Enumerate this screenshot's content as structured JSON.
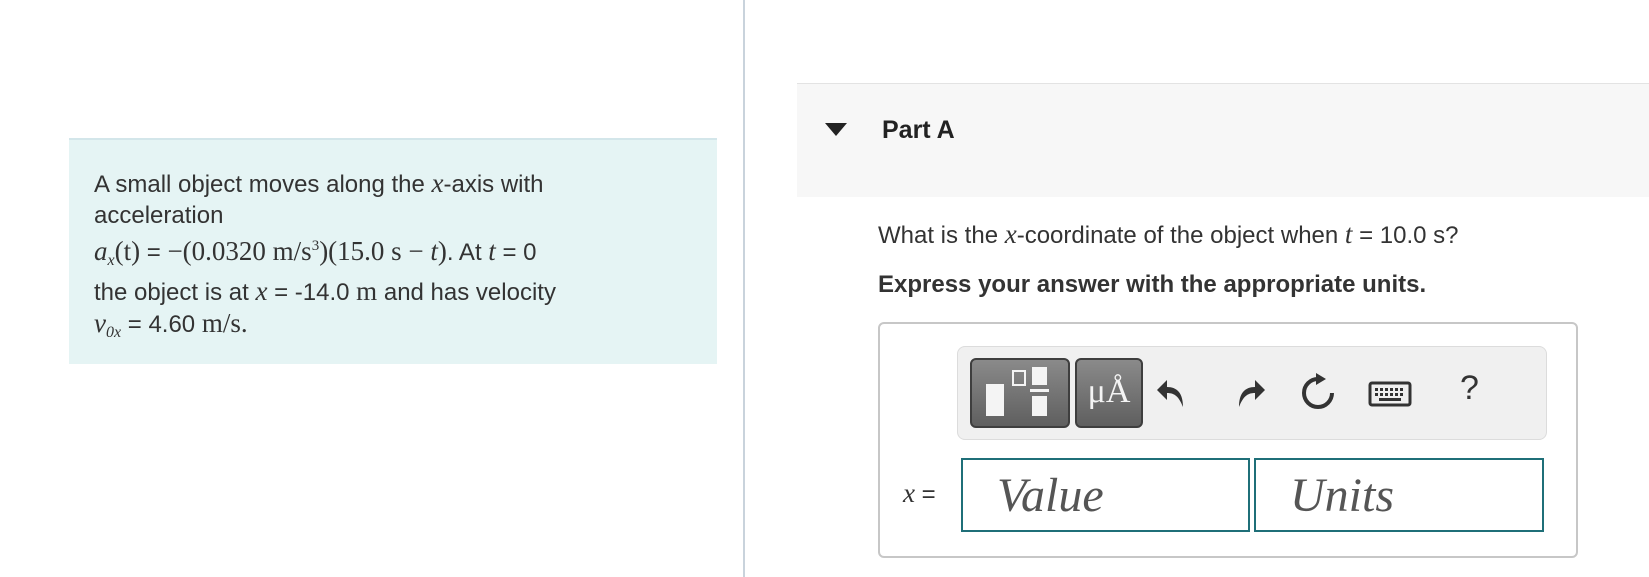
{
  "problem": {
    "line1_text": "A small object moves along the ",
    "line1_var": "x",
    "line1_after": "-axis with",
    "line2": "acceleration",
    "accel_symbol": "a",
    "accel_sub": "x",
    "accel_arg": "(t)",
    "accel_eq": " = ",
    "accel_expr_a": "−(0.0320 m/s",
    "accel_expr_exp": "3",
    "accel_expr_b": ")(15.0 s − ",
    "accel_expr_t": "t",
    "accel_expr_c": ")",
    "at_text": ". At ",
    "at_var": "t",
    "at_value": " = 0",
    "line4_a": "the object is at ",
    "line4_var": "x",
    "line4_eq": " = -14.0 ",
    "line4_unit": "m",
    "line4_b": " and has velocity",
    "vel_symbol": "v",
    "vel_sub": "0x",
    "vel_eq": " = 4.60 ",
    "vel_unit": "m/s."
  },
  "part": {
    "title": "Part A",
    "question_a": "What is the ",
    "question_var": "x",
    "question_b": "-coordinate of the object when ",
    "question_t": "t",
    "question_c": " = 10.0 s?",
    "instruction": "Express your answer with the appropriate units."
  },
  "toolbar": {
    "units_label": "μÅ",
    "help_label": "?",
    "icons": [
      "templates-icon",
      "units-icon",
      "undo-icon",
      "redo-icon",
      "reset-icon",
      "keyboard-icon",
      "help-icon"
    ]
  },
  "answer": {
    "var": "x",
    "eq": " =",
    "value_placeholder": "Value",
    "units_placeholder": "Units"
  },
  "colors": {
    "problem_bg": "#e5f4f4",
    "field_border": "#1f6f78",
    "header_bg": "#f7f7f7"
  }
}
